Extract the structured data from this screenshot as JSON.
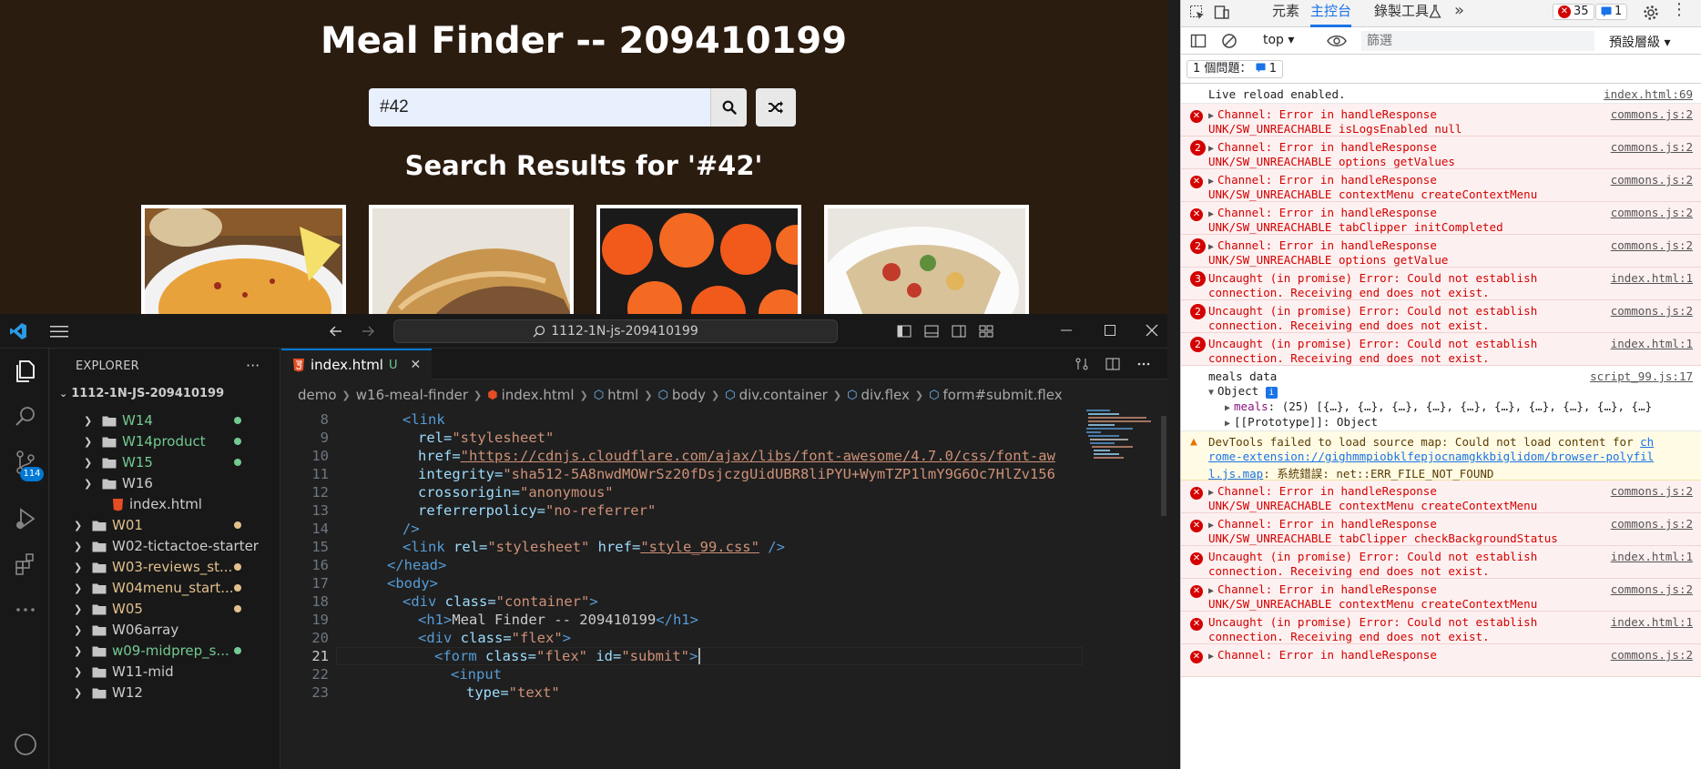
{
  "browser": {
    "title": "Meal Finder -- 209410199",
    "search_value": "#42",
    "results_heading": "Search Results for '#42'"
  },
  "vscode": {
    "command_center": "1112-1N-js-209410199",
    "explorer_title": "EXPLORER",
    "root_folder": "1112-1N-JS-209410199",
    "scm_badge": "114",
    "tree": [
      {
        "label": "W14",
        "color": "#73c991",
        "dot": "#73c991"
      },
      {
        "label": "W14product",
        "color": "#73c991",
        "dot": "#73c991"
      },
      {
        "label": "W15",
        "color": "#73c991",
        "dot": "#73c991"
      },
      {
        "label": "W16",
        "color": "#cccccc",
        "dot": ""
      },
      {
        "label": "index.html",
        "color": "#cccccc",
        "dot": ""
      },
      {
        "label": "W01",
        "color": "#e2c08d",
        "dot": "#e2c08d"
      },
      {
        "label": "W02-tictactoe-starter",
        "color": "#cccccc",
        "dot": ""
      },
      {
        "label": "W03-reviews_st...",
        "color": "#e2c08d",
        "dot": "#e2c08d"
      },
      {
        "label": "W04menu_start...",
        "color": "#e2c08d",
        "dot": "#e2c08d"
      },
      {
        "label": "W05",
        "color": "#e2c08d",
        "dot": "#e2c08d"
      },
      {
        "label": "W06array",
        "color": "#cccccc",
        "dot": ""
      },
      {
        "label": "w09-midprep_s...",
        "color": "#73c991",
        "dot": "#73c991"
      },
      {
        "label": "W11-mid",
        "color": "#cccccc",
        "dot": ""
      },
      {
        "label": "W12",
        "color": "#cccccc",
        "dot": ""
      }
    ],
    "tab": {
      "label": "index.html",
      "status": "U"
    },
    "breadcrumbs": [
      "demo",
      "w16-meal-finder",
      "index.html",
      "html",
      "body",
      "div.container",
      "div.flex",
      "form#submit.flex"
    ],
    "line_numbers": [
      "8",
      "9",
      "10",
      "11",
      "12",
      "13",
      "14",
      "15",
      "16",
      "17",
      "18",
      "19",
      "20",
      "21",
      "22",
      "23"
    ],
    "code": {
      "l8a": "<link",
      "l9a": "rel=",
      "l9b": "\"stylesheet\"",
      "l10a": "href=",
      "l10b": "\"https://cdnjs.cloudflare.com/ajax/libs/font-awesome/4.7.0/css/font-aw",
      "l11a": "integrity=",
      "l11b": "\"sha512-5A8nwdMOWrSz20fDsjczgUidUBR8liPYU+WymTZP1lmY9G6Oc7HlZv156",
      "l12a": "crossorigin=",
      "l12b": "\"anonymous\"",
      "l13a": "referrerpolicy=",
      "l13b": "\"no-referrer\"",
      "l14a": "/>",
      "l15a": "<link ",
      "l15b": "rel=",
      "l15c": "\"stylesheet\"",
      "l15d": " href=",
      "l15e": "\"style_99.css\"",
      "l15f": " />",
      "l16a": "</head>",
      "l17a": "<body>",
      "l18a": "<div ",
      "l18b": "class=",
      "l18c": "\"container\"",
      "l18d": ">",
      "l19a": "<h1>",
      "l19b": "Meal Finder -- 209410199",
      "l19c": "</h1>",
      "l20a": "<div ",
      "l20b": "class=",
      "l20c": "\"flex\"",
      "l20d": ">",
      "l21a": "<form ",
      "l21b": "class=",
      "l21c": "\"flex\"",
      "l21d": " id=",
      "l21e": "\"submit\"",
      "l21f": ">",
      "l22a": "<input",
      "l23a": "type=",
      "l23b": "\"text\""
    }
  },
  "devtools": {
    "tabs": [
      "元素",
      "主控台",
      "錄製工具"
    ],
    "error_count": "35",
    "message_count": "1",
    "context": "top",
    "filter_placeholder": "篩選",
    "levels": "預設層級",
    "issues": "1 個問題：",
    "issues_count": "1",
    "messages": [
      {
        "type": "info",
        "l1": "Live reload enabled.",
        "l2": "",
        "src": "index.html:69",
        "count": ""
      },
      {
        "type": "err",
        "l1": "Channel: Error in handleResponse",
        "l2": "UNK/SW_UNREACHABLE isLogsEnabled null",
        "src": "commons.js:2",
        "count": ""
      },
      {
        "type": "err",
        "l1": "Channel: Error in handleResponse",
        "l2": "UNK/SW_UNREACHABLE options getValues",
        "src": "commons.js:2",
        "count": "2"
      },
      {
        "type": "err",
        "l1": "Channel: Error in handleResponse",
        "l2": "UNK/SW_UNREACHABLE contextMenu createContextMenu",
        "src": "commons.js:2",
        "count": ""
      },
      {
        "type": "err",
        "l1": "Channel: Error in handleResponse",
        "l2": "UNK/SW_UNREACHABLE tabClipper initCompleted",
        "src": "commons.js:2",
        "count": ""
      },
      {
        "type": "err",
        "l1": "Channel: Error in handleResponse",
        "l2": "UNK/SW_UNREACHABLE options getValue",
        "src": "commons.js:2",
        "count": "2"
      },
      {
        "type": "err",
        "l1": "Uncaught (in promise) Error: Could not establish",
        "l2": "connection. Receiving end does not exist.",
        "src": "index.html:1",
        "count": "3"
      },
      {
        "type": "err",
        "l1": "Uncaught (in promise) Error: Could not establish",
        "l2": "connection. Receiving end does not exist.",
        "src": "commons.js:2",
        "count": "2"
      },
      {
        "type": "err",
        "l1": "Uncaught (in promise) Error: Could not establish",
        "l2": "connection. Receiving end does not exist.",
        "src": "index.html:1",
        "count": "2"
      }
    ],
    "meals_log": {
      "label": "meals data",
      "src": "script_99.js:17",
      "object": "Object",
      "meals_key": "meals",
      "meals_val": "(25) [{…}, {…}, {…}, {…}, {…}, {…}, {…}, {…}, {…}, {…}",
      "proto": "[[Prototype]]: Object"
    },
    "warning": {
      "l1a": "DevTools failed to load source map: Could not load content for ",
      "l1b": "ch",
      "l2": "rome-extension://gighmmpiobklfepjocnamgkkbiglidom/browser-polyfil",
      "l3a": "l.js.map",
      "l3b": ": 系統錯誤: net::ERR_FILE_NOT_FOUND"
    },
    "messages2": [
      {
        "l1": "Channel: Error in handleResponse",
        "l2": "UNK/SW_UNREACHABLE contextMenu createContextMenu",
        "src": "commons.js:2"
      },
      {
        "l1": "Channel: Error in handleResponse",
        "l2": "UNK/SW_UNREACHABLE tabClipper checkBackgroundStatus",
        "src": "commons.js:2"
      },
      {
        "l1": "Uncaught (in promise) Error: Could not establish",
        "l2": "connection. Receiving end does not exist.",
        "src": "index.html:1"
      },
      {
        "l1": "Channel: Error in handleResponse",
        "l2": "UNK/SW_UNREACHABLE contextMenu createContextMenu",
        "src": "commons.js:2"
      },
      {
        "l1": "Uncaught (in promise) Error: Could not establish",
        "l2": "connection. Receiving end does not exist.",
        "src": "index.html:1"
      },
      {
        "l1": "Channel: Error in handleResponse",
        "l2": "",
        "src": "commons.js:2"
      }
    ]
  }
}
